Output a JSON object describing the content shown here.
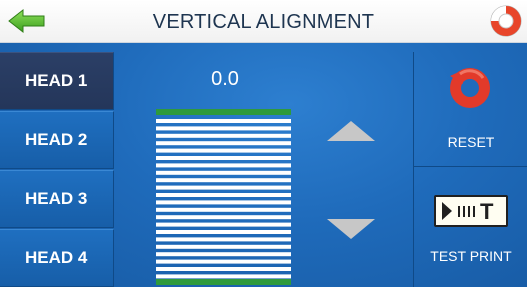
{
  "header": {
    "title": "VERTICAL ALIGNMENT",
    "back_icon": "back-arrow-icon",
    "help_icon": "lifebuoy-help-icon"
  },
  "heads": [
    {
      "label": "HEAD 1",
      "selected": true
    },
    {
      "label": "HEAD 2",
      "selected": false
    },
    {
      "label": "HEAD 3",
      "selected": false
    },
    {
      "label": "HEAD 4",
      "selected": false
    }
  ],
  "alignment": {
    "value": "0.0"
  },
  "actions": {
    "reset_label": "RESET",
    "reset_icon": "reset-icon",
    "test_print_label": "TEST PRINT",
    "test_print_icon": "test-print-icon",
    "test_print_icon_text": "T"
  },
  "colors": {
    "background": "#1a5fa8",
    "selected_head": "#2b3f66",
    "pattern_edge": "#2e9a3c",
    "arrow": "#c7c7c7",
    "reset_red": "#e23a2a"
  }
}
